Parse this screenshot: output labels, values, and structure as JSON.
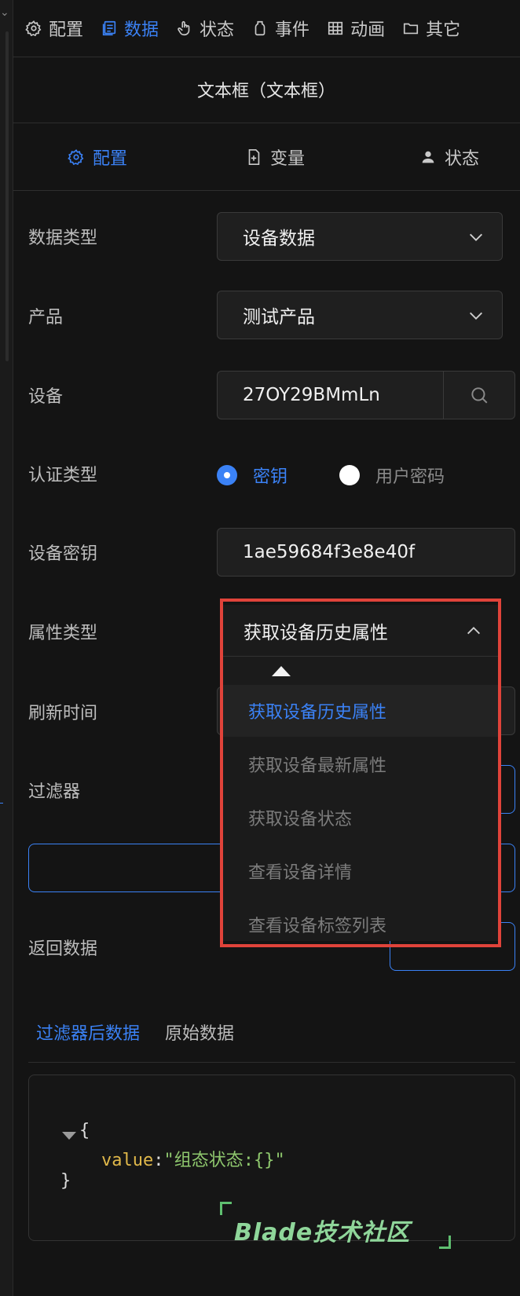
{
  "top_tabs": [
    {
      "label": "配置",
      "icon": "gear-icon"
    },
    {
      "label": "数据",
      "icon": "data-icon",
      "active": true
    },
    {
      "label": "状态",
      "icon": "hand-pointer-icon"
    },
    {
      "label": "事件",
      "icon": "event-icon"
    },
    {
      "label": "动画",
      "icon": "grid-icon"
    },
    {
      "label": "其它",
      "icon": "folder-icon"
    }
  ],
  "panel_title": "文本框（文本框）",
  "sub_tabs": [
    {
      "label": "配置",
      "icon": "gear-icon",
      "active": true
    },
    {
      "label": "变量",
      "icon": "file-plus-icon"
    },
    {
      "label": "状态",
      "icon": "user-icon"
    }
  ],
  "form": {
    "data_type": {
      "label": "数据类型",
      "value": "设备数据"
    },
    "product": {
      "label": "产品",
      "value": "测试产品"
    },
    "device": {
      "label": "设备",
      "value": "27OY29BMmLn"
    },
    "auth_type": {
      "label": "认证类型",
      "options": [
        "密钥",
        "用户密码"
      ],
      "selected": "密钥"
    },
    "device_secret": {
      "label": "设备密钥",
      "value": "1ae59684f3e8e40f"
    },
    "attr_type": {
      "label": "属性类型",
      "value": "获取设备历史属性"
    },
    "refresh_time": {
      "label": "刷新时间"
    },
    "filter": {
      "label": "过滤器"
    },
    "return_data": {
      "label": "返回数据"
    }
  },
  "dropdown": {
    "options": [
      "获取设备历史属性",
      "获取设备最新属性",
      "获取设备状态",
      "查看设备详情",
      "查看设备标签列表"
    ],
    "selected": "获取设备历史属性"
  },
  "result_tabs": [
    {
      "label": "过滤器后数据",
      "active": true
    },
    {
      "label": "原始数据"
    }
  ],
  "code": {
    "open": "{",
    "key": "value",
    "colon": ":",
    "value": "\"组态状态:{}\"",
    "close": "}"
  },
  "watermark": "Blade技术社区",
  "colors": {
    "accent": "#3b82f6",
    "highlight": "#e0433a",
    "background": "#141414"
  }
}
